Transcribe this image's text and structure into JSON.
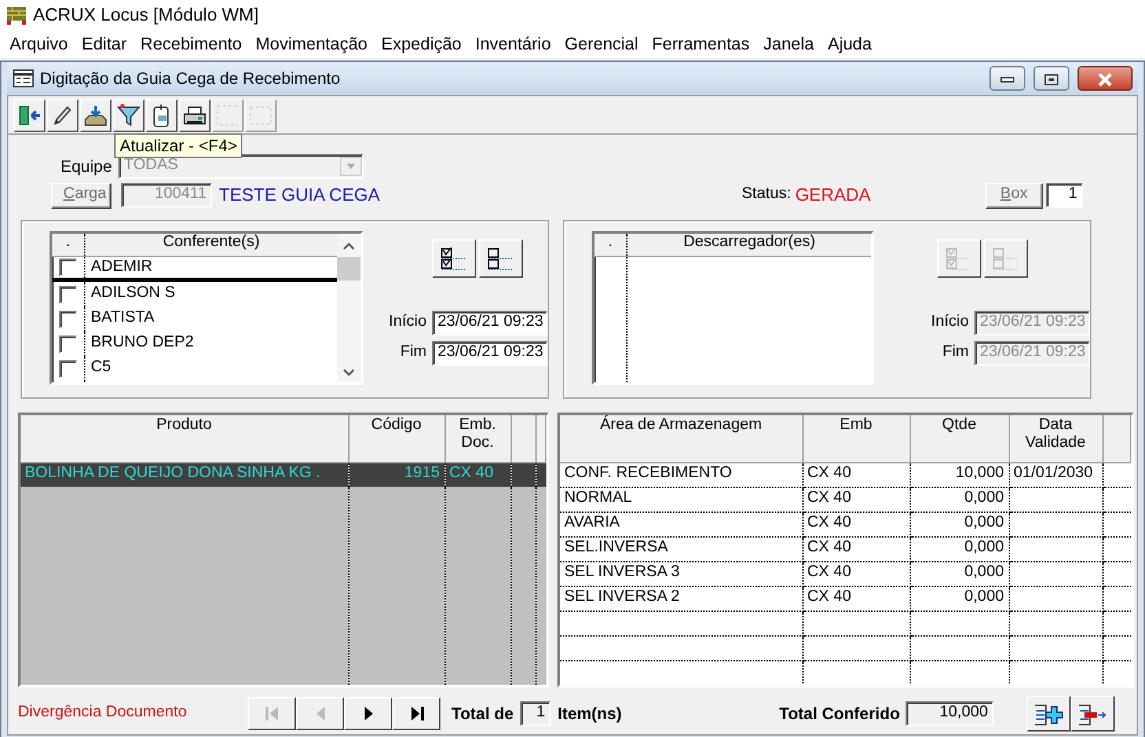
{
  "app": {
    "title": "ACRUX Locus [Módulo WM]"
  },
  "menu": [
    "Arquivo",
    "Editar",
    "Recebimento",
    "Movimentação",
    "Expedição",
    "Inventário",
    "Gerencial",
    "Ferramentas",
    "Janela",
    "Ajuda"
  ],
  "window": {
    "title": "Digitação da Guia Cega de Recebimento"
  },
  "toolbar": [
    {
      "kind": "exit",
      "disabled": false
    },
    {
      "kind": "edit",
      "disabled": false
    },
    {
      "kind": "import",
      "disabled": false
    },
    {
      "kind": "filter",
      "disabled": false
    },
    {
      "kind": "document",
      "disabled": false
    },
    {
      "kind": "print",
      "disabled": false
    },
    {
      "kind": "blank",
      "disabled": true
    },
    {
      "kind": "frame",
      "disabled": true
    }
  ],
  "tooltip": "Atualizar - <F4>",
  "equipe": {
    "label": "Equipe",
    "value": "TODAS",
    "disabled": true
  },
  "carga": {
    "button": "Carga",
    "number": "100411",
    "description": "TESTE GUIA CEGA"
  },
  "status": {
    "label": "Status:",
    "value": "GERADA"
  },
  "box": {
    "button": "Box",
    "value": "1"
  },
  "groups": [
    {
      "columns": [
        ".",
        "Conferente(s)"
      ],
      "disabled": false,
      "rows": [
        {
          "name": "ADEMIR",
          "checked": false,
          "selected": true
        },
        {
          "name": "ADILSON S",
          "checked": false,
          "selected": false
        },
        {
          "name": "BATISTA",
          "checked": false,
          "selected": false
        },
        {
          "name": "BRUNO DEP2",
          "checked": false,
          "selected": false
        },
        {
          "name": "C5",
          "checked": false,
          "selected": false
        }
      ],
      "inicio": {
        "label": "Início",
        "value": "23/06/21 09:23"
      },
      "fim": {
        "label": "Fim",
        "value": "23/06/21 09:23"
      }
    },
    {
      "columns": [
        ".",
        "Descarregador(es)"
      ],
      "disabled": true,
      "inicio": {
        "label": "Início",
        "value": "23/06/21 09:23"
      },
      "fim": {
        "label": "Fim",
        "value": "23/06/21 09:23"
      }
    }
  ],
  "products": {
    "columns": [
      "Produto",
      "Código",
      "Emb. Doc."
    ],
    "rows": [
      {
        "cells": [
          "BOLINHA DE QUEIJO DONA SINHA KG .",
          "1915",
          "CX 40"
        ],
        "selected": true
      }
    ]
  },
  "storage": {
    "columns": [
      "Área de Armazenagem",
      "Emb",
      "Qtde",
      "Data Validade"
    ],
    "rows": [
      [
        "CONF. RECEBIMENTO",
        "CX 40",
        "10,000",
        "01/01/2030"
      ],
      [
        "NORMAL",
        "CX 40",
        "0,000"
      ],
      [
        "AVARIA",
        "CX 40",
        "0,000"
      ],
      [
        "SEL.INVERSA",
        "CX 40",
        "0,000"
      ],
      [
        "SEL INVERSA 3",
        "CX 40",
        "0,000"
      ],
      [
        "SEL INVERSA 2",
        "CX 40",
        "0,000"
      ]
    ]
  },
  "footer": {
    "message": "Divergência Documento",
    "nav": [
      {
        "kind": "first",
        "disabled": true
      },
      {
        "kind": "prev",
        "disabled": true
      },
      {
        "kind": "next",
        "disabled": false
      },
      {
        "kind": "last",
        "disabled": false
      }
    ],
    "total_label": "Total de",
    "total_value": "1",
    "items_label": "Item(ns)",
    "conferido_label": "Total Conferido",
    "conferido_value": "10,000",
    "actions": [
      {
        "kind": "add"
      },
      {
        "kind": "leave"
      }
    ]
  }
}
